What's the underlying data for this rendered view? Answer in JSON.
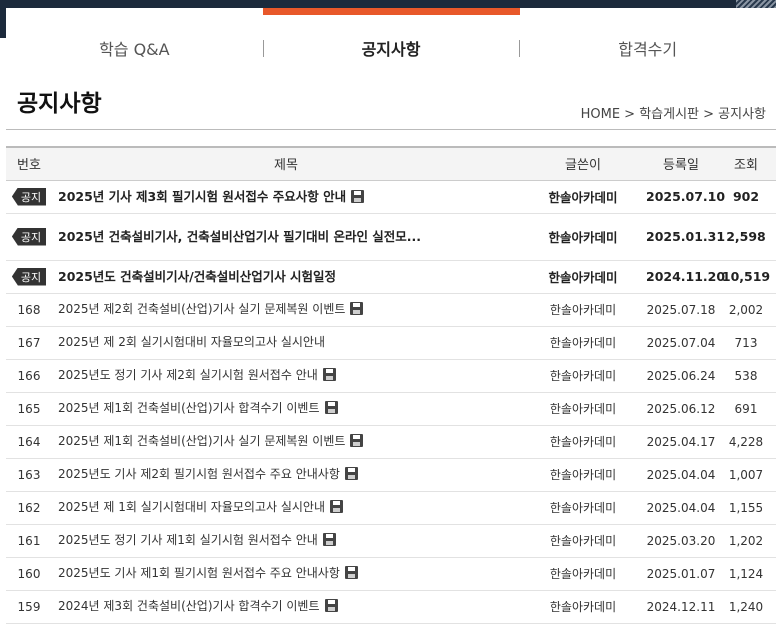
{
  "tabs": [
    {
      "label": "학습 Q&A",
      "active": false
    },
    {
      "label": "공지사항",
      "active": true
    },
    {
      "label": "합격수기",
      "active": false
    }
  ],
  "page_title": "공지사항",
  "breadcrumb": "HOME > 학습게시판 > 공지사항",
  "columns": {
    "no": "번호",
    "title": "제목",
    "writer": "글쓴이",
    "date": "등록일",
    "views": "조회"
  },
  "notice_badge": "공지",
  "rows": [
    {
      "no": "공지",
      "title": "2025년 기사 제3회 필기시험 원서접수 주요사항 안내",
      "writer": "한솔아카데미",
      "date": "2025.07.10",
      "views": "902"
    },
    {
      "no": "공지",
      "title": "2025년 건축설비기사, 건축설비산업기사 필기대비 온라인 실전모...",
      "writer": "한솔아카데미",
      "date": "2025.01.31",
      "views": "2,598"
    },
    {
      "no": "공지",
      "title": "2025년도 건축설비기사/건축설비산업기사 시험일정",
      "writer": "한솔아카데미",
      "date": "2024.11.20",
      "views": "10,519"
    },
    {
      "no": "168",
      "title": "2025년 제2회 건축설비(산업)기사 실기 문제복원 이벤트",
      "writer": "한솔아카데미",
      "date": "2025.07.18",
      "views": "2,002"
    },
    {
      "no": "167",
      "title": "2025년 제 2회 실기시험대비 자율모의고사 실시안내",
      "writer": "한솔아카데미",
      "date": "2025.07.04",
      "views": "713"
    },
    {
      "no": "166",
      "title": "2025년도 정기 기사 제2회 실기시험 원서접수 안내",
      "writer": "한솔아카데미",
      "date": "2025.06.24",
      "views": "538"
    },
    {
      "no": "165",
      "title": "2025년 제1회 건축설비(산업)기사 합격수기 이벤트",
      "writer": "한솔아카데미",
      "date": "2025.06.12",
      "views": "691"
    },
    {
      "no": "164",
      "title": "2025년 제1회 건축설비(산업)기사 실기 문제복원 이벤트",
      "writer": "한솔아카데미",
      "date": "2025.04.17",
      "views": "4,228"
    },
    {
      "no": "163",
      "title": "2025년도 기사 제2회 필기시험 원서접수 주요 안내사항",
      "writer": "한솔아카데미",
      "date": "2025.04.04",
      "views": "1,007"
    },
    {
      "no": "162",
      "title": "2025년 제 1회 실기시험대비 자율모의고사 실시안내",
      "writer": "한솔아카데미",
      "date": "2025.04.04",
      "views": "1,155"
    },
    {
      "no": "161",
      "title": "2025년도 정기 기사 제1회 실기시험 원서접수 안내",
      "writer": "한솔아카데미",
      "date": "2025.03.20",
      "views": "1,202"
    },
    {
      "no": "160",
      "title": "2025년도 기사 제1회 필기시험 원서접수 주요 안내사항",
      "writer": "한솔아카데미",
      "date": "2025.01.07",
      "views": "1,124"
    },
    {
      "no": "159",
      "title": "2024년 제3회 건축설비(산업)기사 합격수기 이벤트",
      "writer": "한솔아카데미",
      "date": "2024.12.11",
      "views": "1,240"
    }
  ]
}
